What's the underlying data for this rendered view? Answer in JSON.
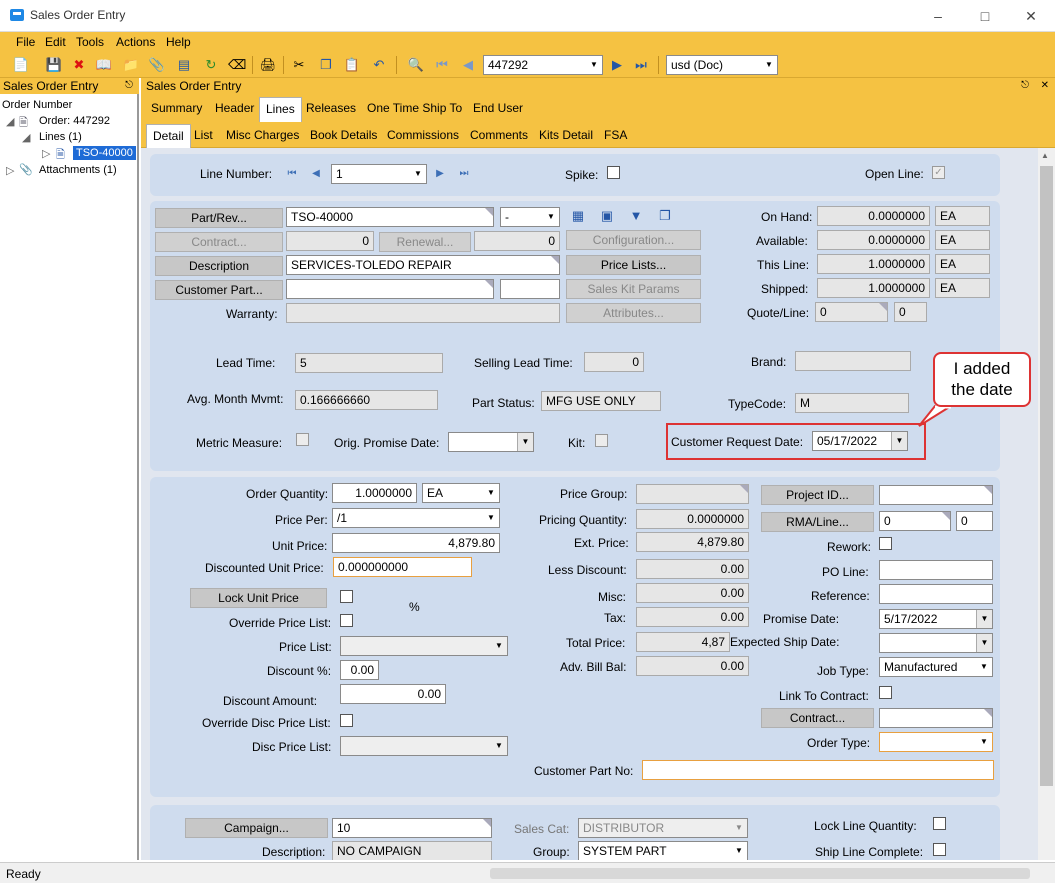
{
  "window": {
    "title": "Sales Order Entry"
  },
  "menu": [
    "File",
    "Edit",
    "Tools",
    "Actions",
    "Help"
  ],
  "toolbar": {
    "order_number": "447292",
    "currency": "usd (Doc)"
  },
  "left_panel": {
    "header": "Sales Order Entry",
    "tree": {
      "root": "Order Number",
      "order": "Order: 447292",
      "lines": "Lines (1)",
      "line_item": "TSO-40000",
      "attachments": "Attachments (1)"
    }
  },
  "right_panel": {
    "header": "Sales Order Entry"
  },
  "tabs_primary": [
    "Summary",
    "Header",
    "Lines",
    "Releases",
    "One Time Ship To",
    "End User"
  ],
  "tabs_secondary": [
    "Detail",
    "List",
    "Misc Charges",
    "Book Details",
    "Commissions",
    "Comments",
    "Kits Detail",
    "FSA"
  ],
  "line_header": {
    "line_number_label": "Line Number:",
    "line_number": "1",
    "spike_label": "Spike:",
    "open_line_label": "Open Line:"
  },
  "part": {
    "part_rev_btn": "Part/Rev...",
    "part_value": "TSO-40000",
    "rev_value": "-",
    "contract_btn": "Contract...",
    "contract_value": "0",
    "renewal_btn": "Renewal...",
    "renewal_value": "0",
    "description_btn": "Description",
    "description_value": "SERVICES-TOLEDO REPAIR",
    "customer_part_btn": "Customer Part...",
    "warranty_label": "Warranty:",
    "configuration_btn": "Configuration...",
    "price_lists_btn": "Price Lists...",
    "sales_kit_btn": "Sales Kit Params",
    "attributes_btn": "Attributes..."
  },
  "stock": {
    "on_hand_label": "On Hand:",
    "on_hand": "0.0000000",
    "on_hand_uom": "EA",
    "available_label": "Available:",
    "available": "0.0000000",
    "available_uom": "EA",
    "this_line_label": "This Line:",
    "this_line": "1.0000000",
    "this_line_uom": "EA",
    "shipped_label": "Shipped:",
    "shipped": "1.0000000",
    "shipped_uom": "EA",
    "quote_line_label": "Quote/Line:",
    "quote": "0",
    "quote_line": "0"
  },
  "info": {
    "lead_time_label": "Lead Time:",
    "lead_time": "5",
    "selling_lead_time_label": "Selling Lead Time:",
    "selling_lead_time": "0",
    "brand_label": "Brand:",
    "avg_month_label": "Avg. Month Mvmt:",
    "avg_month": "0.166666660",
    "part_status_label": "Part Status:",
    "part_status": "MFG USE ONLY",
    "typecode_label": "TypeCode:",
    "typecode": "M",
    "metric_label": "Metric Measure:",
    "orig_promise_label": "Orig. Promise Date:",
    "kit_label": "Kit:",
    "customer_request_label": "Customer Request Date:",
    "customer_request_date": "05/17/2022"
  },
  "callout": {
    "text_line1": "I added",
    "text_line2": "the date"
  },
  "pricing": {
    "order_qty_label": "Order Quantity:",
    "order_qty": "1.0000000",
    "order_qty_uom": "EA",
    "price_per_label": "Price Per:",
    "price_per": "/1",
    "unit_price_label": "Unit Price:",
    "unit_price": "4,879.80",
    "disc_unit_price_label": "Discounted Unit Price:",
    "disc_unit_price": "0.000000000",
    "lock_unit_price_btn": "Lock Unit Price",
    "percent": "%",
    "override_price_list_label": "Override Price List:",
    "price_list_label": "Price List:",
    "discount_pct_label": "Discount %:",
    "discount_pct": "0.00",
    "discount_amount_label": "Discount Amount:",
    "discount_amount": "0.00",
    "override_disc_label": "Override Disc Price List:",
    "disc_price_list_label": "Disc Price List:",
    "price_group_label": "Price Group:",
    "pricing_qty_label": "Pricing Quantity:",
    "pricing_qty": "0.0000000",
    "ext_price_label": "Ext. Price:",
    "ext_price": "4,879.80",
    "less_discount_label": "Less Discount:",
    "less_discount": "0.00",
    "misc_label": "Misc:",
    "misc": "0.00",
    "tax_label": "Tax:",
    "tax": "0.00",
    "total_price_label": "Total Price:",
    "total_price": "4,87",
    "adv_bill_label": "Adv. Bill Bal:",
    "adv_bill": "0.00",
    "project_id_btn": "Project ID...",
    "rma_line_btn": "RMA/Line...",
    "rma": "0",
    "rma_line": "0",
    "rework_label": "Rework:",
    "po_line_label": "PO Line:",
    "reference_label": "Reference:",
    "promise_date_label": "Promise Date:",
    "promise_date": "5/17/2022",
    "expected_ship_label": "Expected Ship Date:",
    "job_type_label": "Job Type:",
    "job_type": "Manufactured",
    "link_contract_label": "Link To Contract:",
    "contract_btn": "Contract...",
    "order_type_label": "Order Type:",
    "customer_part_no_label": "Customer Part No:"
  },
  "campaign": {
    "campaign_btn": "Campaign...",
    "campaign_value": "10",
    "description_label": "Description:",
    "description_value": "NO CAMPAIGN",
    "sales_cat_label": "Sales Cat:",
    "sales_cat": "DISTRIBUTOR",
    "group_label": "Group:",
    "group": "SYSTEM PART",
    "lock_line_qty_label": "Lock Line Quantity:",
    "ship_line_complete_label": "Ship Line Complete:"
  },
  "status": {
    "text": "Ready"
  }
}
